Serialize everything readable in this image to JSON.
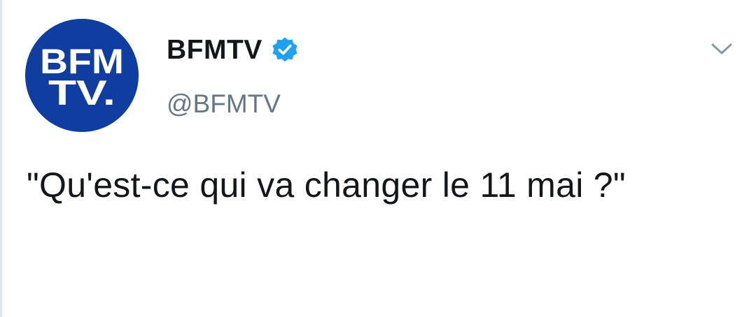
{
  "tweet": {
    "author": {
      "display_name": "BFMTV",
      "handle": "@BFMTV",
      "verified": true,
      "avatar": {
        "icon": "bfmtv-logo",
        "logo_line1": "BFM",
        "logo_line2": "TV."
      }
    },
    "text": "\"Qu'est-ce qui va changer le 11 mai ?\"",
    "menu_icon": "chevron-down-icon"
  },
  "colors": {
    "brand_blue": "#0f3da0",
    "verified_blue": "#1da1f2",
    "handle_gray": "#657786",
    "text": "#14171a",
    "caret_gray": "#8899a6"
  }
}
